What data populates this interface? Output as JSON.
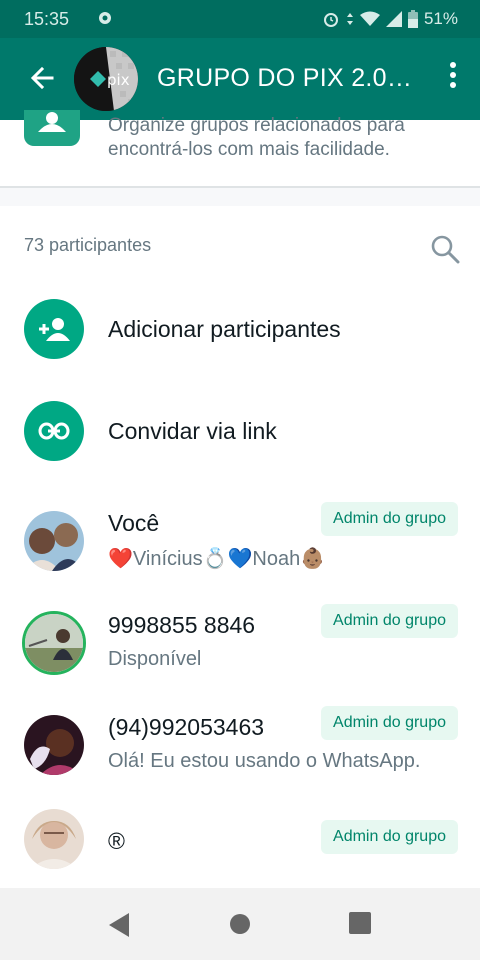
{
  "status_bar": {
    "time": "15:35",
    "battery": "51%"
  },
  "app_bar": {
    "title": "GRUPO DO PIX 2.0…",
    "avatar_text": "pix"
  },
  "community": {
    "description": "Organize grupos relacionados para encontrá-los com mais facilidade."
  },
  "participants": {
    "count_label": "73 participantes",
    "actions": [
      {
        "label": "Adicionar participantes",
        "icon": "add-person-icon"
      },
      {
        "label": "Convidar via link",
        "icon": "link-icon"
      }
    ],
    "members": [
      {
        "name": "Você",
        "status": "❤️Vinícius💍💙Noah👶🏽",
        "badge": "Admin do grupo"
      },
      {
        "name": " 9998855 8846",
        "status": "Disponível",
        "badge": "Admin do grupo"
      },
      {
        "name": "(94)992053463",
        "status": "Olá! Eu estou usando o WhatsApp.",
        "badge": "Admin do grupo"
      },
      {
        "name": "®",
        "status": "",
        "badge": "Admin do grupo"
      }
    ]
  },
  "colors": {
    "app_bar": "#00796b",
    "status_bar": "#006d5f",
    "accent": "#00a884",
    "badge_bg": "#e7f8f1",
    "badge_text": "#00856a"
  }
}
